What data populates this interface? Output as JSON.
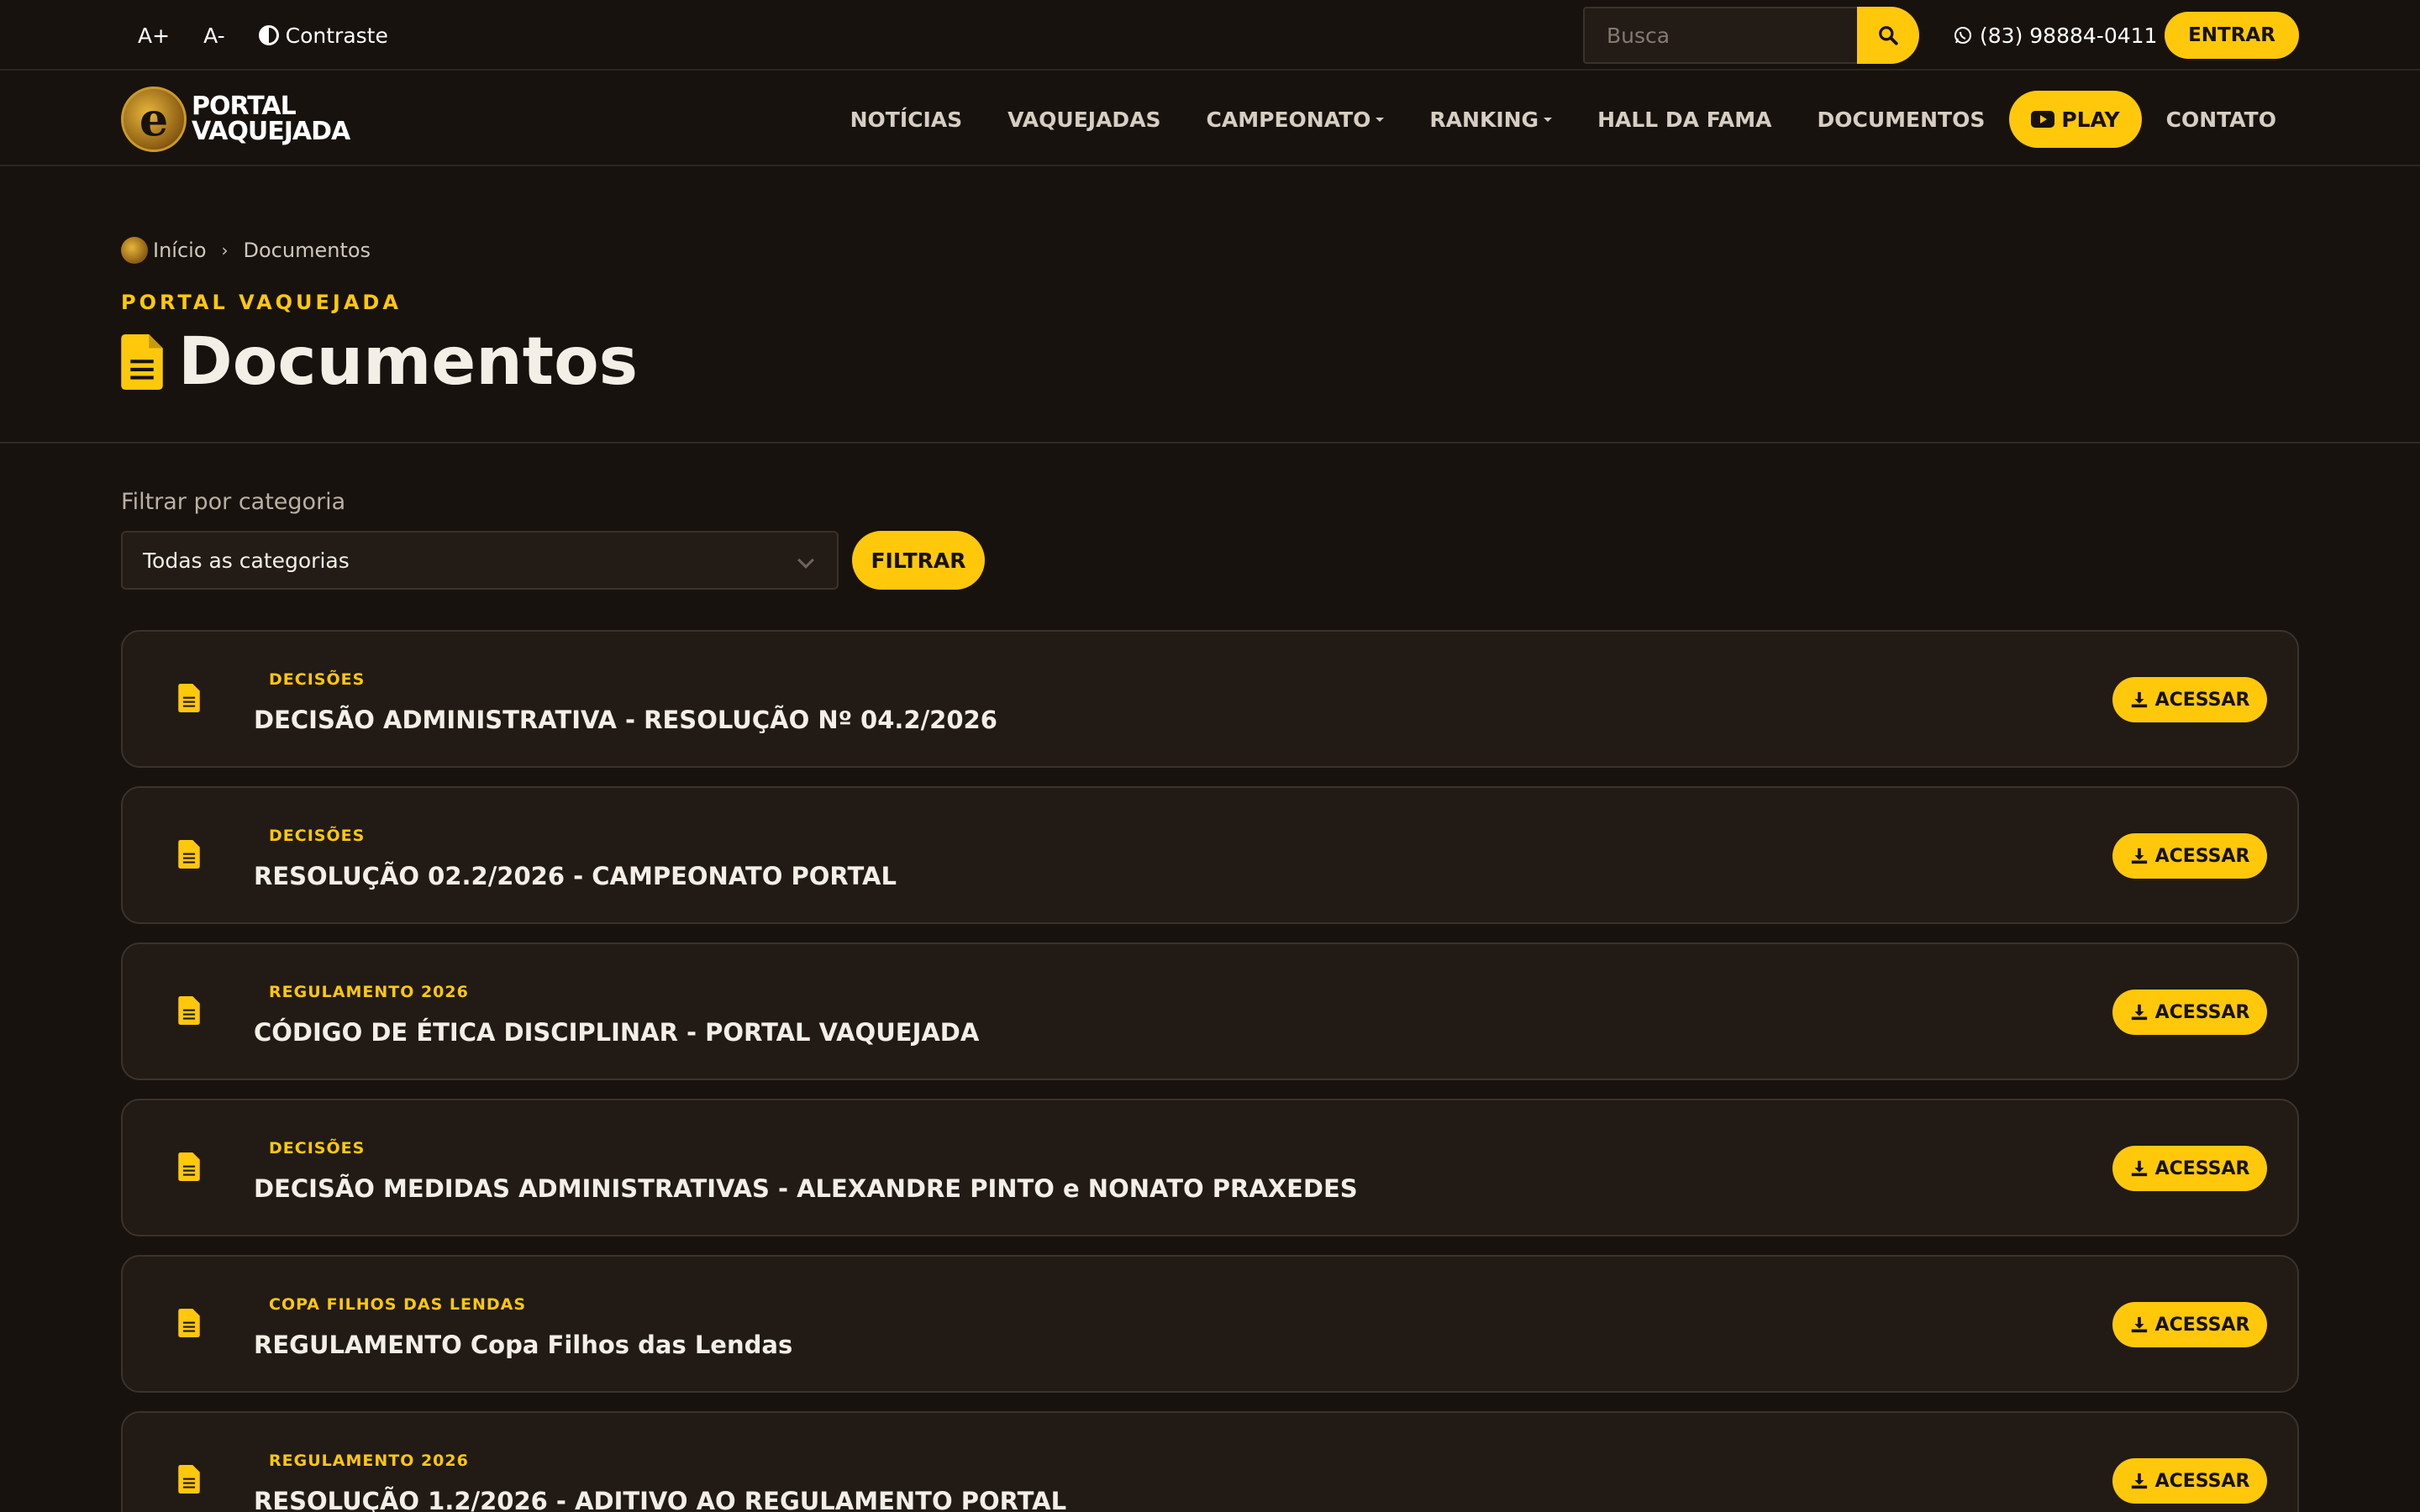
{
  "topbar": {
    "font_increase": "A+",
    "font_decrease": "A-",
    "contrast": "Contraste",
    "search_placeholder": "Busca",
    "phone": "(83) 98884-0411",
    "login": "ENTRAR"
  },
  "brand": {
    "line1": "PORTAL",
    "line2": "VAQUEJADA",
    "mark": "e"
  },
  "nav": {
    "items": [
      {
        "label": "NOTÍCIAS"
      },
      {
        "label": "VAQUEJADAS"
      },
      {
        "label": "CAMPEONATO"
      },
      {
        "label": "RANKING"
      },
      {
        "label": "HALL DA FAMA"
      },
      {
        "label": "DOCUMENTOS"
      },
      {
        "label": "PLAY"
      },
      {
        "label": "CONTATO"
      }
    ]
  },
  "breadcrumb": {
    "home": "Início",
    "current": "Documentos"
  },
  "hero": {
    "eyebrow": "PORTAL VAQUEJADA",
    "title": "Documentos"
  },
  "filter": {
    "label": "Filtrar por categoria",
    "selected": "Todas as categorias",
    "button": "FILTRAR"
  },
  "documents": [
    {
      "category": "DECISÕES",
      "title": "DECISÃO ADMINISTRATIVA - RESOLUÇÃO Nº 04.2/2026",
      "action": "ACESSAR"
    },
    {
      "category": "DECISÕES",
      "title": "RESOLUÇÃO 02.2/2026 - CAMPEONATO PORTAL",
      "action": "ACESSAR"
    },
    {
      "category": "REGULAMENTO 2026",
      "title": "CÓDIGO DE ÉTICA DISCIPLINAR - PORTAL VAQUEJADA",
      "action": "ACESSAR"
    },
    {
      "category": "DECISÕES",
      "title": "DECISÃO MEDIDAS ADMINISTRATIVAS - ALEXANDRE PINTO e NONATO PRAXEDES",
      "action": "ACESSAR"
    },
    {
      "category": "COPA FILHOS DAS LENDAS",
      "title": "REGULAMENTO Copa Filhos das Lendas",
      "action": "ACESSAR"
    },
    {
      "category": "REGULAMENTO 2026",
      "title": "RESOLUÇÃO 1.2/2026 - ADITIVO AO REGULAMENTO PORTAL",
      "action": "ACESSAR"
    }
  ],
  "colors": {
    "background": "#17120e",
    "card": "#211a15",
    "accent": "#ffc80b",
    "text": "#f3efe6"
  },
  "icons": {
    "search": "search-icon",
    "whatsapp": "whatsapp-icon",
    "contrast": "contrast-icon",
    "document": "file-text-icon",
    "download": "download-icon",
    "youtube": "youtube-icon"
  }
}
